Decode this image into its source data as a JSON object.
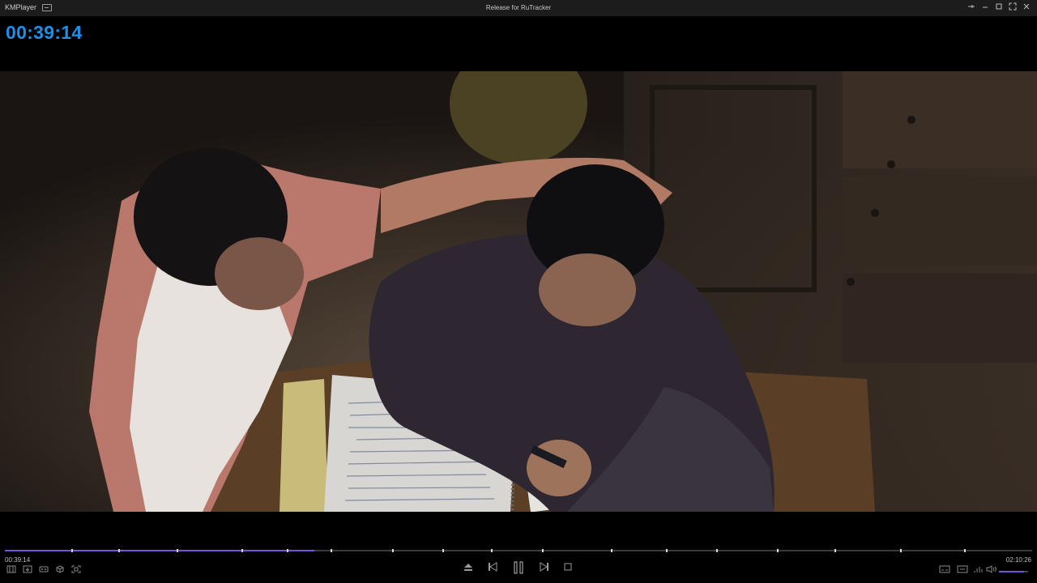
{
  "titlebar": {
    "app_name": "KMPlayer",
    "title": "Release for RuTracker",
    "buttons": [
      "pin-icon",
      "minimize-icon",
      "maximize-icon",
      "fullscreen-icon",
      "close-icon"
    ]
  },
  "osd": {
    "time": "00:39:14"
  },
  "playback": {
    "current_time": "00:39:14",
    "total_time": "02:10:26",
    "progress": 0.301,
    "volume": 0.85
  },
  "colors": {
    "accent": "#7b4fe0",
    "osd_text": "#1e8fe6"
  }
}
